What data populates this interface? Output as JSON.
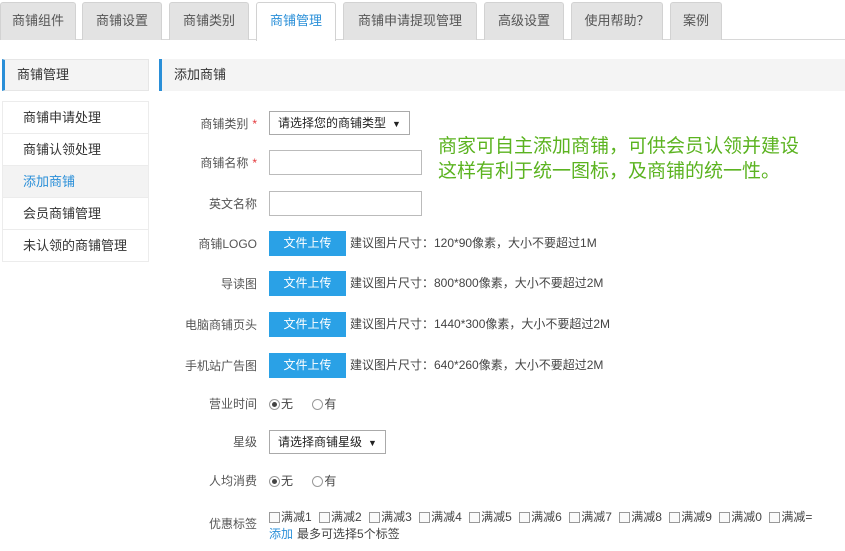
{
  "tabs": [
    {
      "label": "商铺组件"
    },
    {
      "label": "商铺设置"
    },
    {
      "label": "商铺类别"
    },
    {
      "label": "商铺管理"
    },
    {
      "label": "商铺申请提现管理"
    },
    {
      "label": "高级设置"
    },
    {
      "label": "使用帮助？"
    },
    {
      "label": "案例"
    }
  ],
  "active_tab_index": 3,
  "sidebar": {
    "title": "商铺管理",
    "items": [
      {
        "label": "商铺申请处理"
      },
      {
        "label": "商铺认领处理"
      },
      {
        "label": "添加商铺"
      },
      {
        "label": "会员商铺管理"
      },
      {
        "label": "未认领的商铺管理"
      }
    ],
    "active_index": 2
  },
  "main": {
    "title": "添加商铺",
    "required_mark": "*",
    "shop_type": {
      "label": "商铺类别",
      "value": "请选择您的商铺类型"
    },
    "shop_name": {
      "label": "商铺名称",
      "value": ""
    },
    "english_name": {
      "label": "英文名称",
      "value": ""
    },
    "upload_button_label": "文件上传",
    "logo": {
      "label": "商铺LOGO",
      "hint": "建议图片尺寸：120*90像素，大小不要超过1M"
    },
    "guide_image": {
      "label": "导读图",
      "hint": "建议图片尺寸：800*800像素，大小不要超过2M"
    },
    "pc_banner": {
      "label": "电脑商铺页头",
      "hint": "建议图片尺寸：1440*300像素，大小不要超过2M"
    },
    "mobile_ad": {
      "label": "手机站广告图",
      "hint": "建议图片尺寸：640*260像素，大小不要超过2M"
    },
    "business_hours": {
      "label": "营业时间",
      "options": [
        "无",
        "有"
      ],
      "selected": 0
    },
    "star_level": {
      "label": "星级",
      "value": "请选择商铺星级"
    },
    "avg_spend": {
      "label": "人均消费",
      "options": [
        "无",
        "有"
      ],
      "selected": 0
    },
    "discount_tags": {
      "label": "优惠标签",
      "options": [
        "满减1",
        "满减2",
        "满减3",
        "满减4",
        "满减5",
        "满减6",
        "满减7",
        "满减8",
        "满减9",
        "满减0",
        "满减="
      ],
      "add_label": "添加",
      "add_note": "最多可选择5个标签"
    }
  },
  "annotation": {
    "line1": "商家可自主添加商铺，可供会员认领并建设",
    "line2": "这样有利于统一图标，及商铺的统一性。",
    "color": "#5bb320"
  },
  "colors": {
    "accent": "#2a8fd8",
    "upload_button": "#2aa1e6",
    "required": "#e4393c"
  }
}
